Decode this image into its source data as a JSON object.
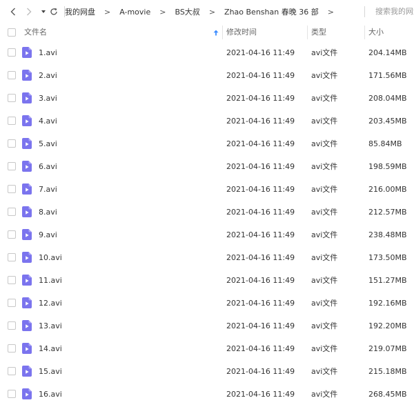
{
  "toolbar": {
    "back_icon": "chevron-left-icon",
    "forward_icon": "chevron-right-icon",
    "dropdown_icon": "caret-down-icon",
    "refresh_icon": "refresh-icon"
  },
  "breadcrumb": {
    "items": [
      "我的网盘",
      "A-movie",
      "BS大叔",
      "Zhao Benshan 春晚 36 部"
    ],
    "separator": ">"
  },
  "search": {
    "placeholder": "搜索我的网盘"
  },
  "table": {
    "headers": {
      "name": "文件名",
      "modified": "修改时间",
      "type": "类型",
      "size": "大小"
    },
    "sort": {
      "column": "name",
      "direction": "asc",
      "icon": "sort-up-arrow-icon"
    },
    "accent_color": "#3b8cff",
    "file_icon_color": "#7b74ee",
    "rows": [
      {
        "name": "1.avi",
        "modified": "2021-04-16 11:49",
        "type": "avi文件",
        "size": "204.14MB"
      },
      {
        "name": "2.avi",
        "modified": "2021-04-16 11:49",
        "type": "avi文件",
        "size": "171.56MB"
      },
      {
        "name": "3.avi",
        "modified": "2021-04-16 11:49",
        "type": "avi文件",
        "size": "208.04MB"
      },
      {
        "name": "4.avi",
        "modified": "2021-04-16 11:49",
        "type": "avi文件",
        "size": "203.45MB"
      },
      {
        "name": "5.avi",
        "modified": "2021-04-16 11:49",
        "type": "avi文件",
        "size": "85.84MB"
      },
      {
        "name": "6.avi",
        "modified": "2021-04-16 11:49",
        "type": "avi文件",
        "size": "198.59MB"
      },
      {
        "name": "7.avi",
        "modified": "2021-04-16 11:49",
        "type": "avi文件",
        "size": "216.00MB"
      },
      {
        "name": "8.avi",
        "modified": "2021-04-16 11:49",
        "type": "avi文件",
        "size": "212.57MB"
      },
      {
        "name": "9.avi",
        "modified": "2021-04-16 11:49",
        "type": "avi文件",
        "size": "238.48MB"
      },
      {
        "name": "10.avi",
        "modified": "2021-04-16 11:49",
        "type": "avi文件",
        "size": "173.50MB"
      },
      {
        "name": "11.avi",
        "modified": "2021-04-16 11:49",
        "type": "avi文件",
        "size": "151.27MB"
      },
      {
        "name": "12.avi",
        "modified": "2021-04-16 11:49",
        "type": "avi文件",
        "size": "192.16MB"
      },
      {
        "name": "13.avi",
        "modified": "2021-04-16 11:49",
        "type": "avi文件",
        "size": "192.20MB"
      },
      {
        "name": "14.avi",
        "modified": "2021-04-16 11:49",
        "type": "avi文件",
        "size": "219.07MB"
      },
      {
        "name": "15.avi",
        "modified": "2021-04-16 11:49",
        "type": "avi文件",
        "size": "215.18MB"
      },
      {
        "name": "16.avi",
        "modified": "2021-04-16 11:49",
        "type": "avi文件",
        "size": "268.45MB"
      }
    ]
  }
}
